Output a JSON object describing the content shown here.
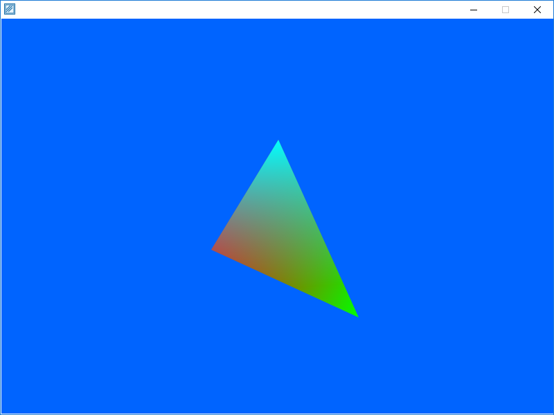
{
  "window": {
    "title": "",
    "icon": "app-window-icon",
    "controls": {
      "minimize_icon": "minimize-icon",
      "maximize_icon": "maximize-icon",
      "close_icon": "close-icon"
    }
  },
  "render": {
    "clear_color": "#0064ff",
    "triangle": {
      "vertex_colors": [
        "#ff0000",
        "#00ff00",
        "#00ffff"
      ]
    }
  }
}
